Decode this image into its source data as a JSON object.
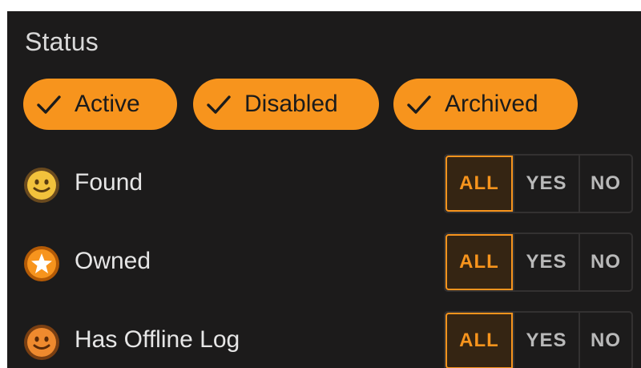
{
  "status": {
    "title": "Status",
    "chips": [
      {
        "label": "Active",
        "checked": true
      },
      {
        "label": "Disabled",
        "checked": true
      },
      {
        "label": "Archived",
        "checked": true
      }
    ],
    "chip_color": "#f7941d"
  },
  "filters": [
    {
      "label": "Found",
      "icon": "smiley-found-icon",
      "icon_color": "#f2c23c",
      "selected": "ALL"
    },
    {
      "label": "Owned",
      "icon": "star-owned-icon",
      "icon_color": "#f7941d",
      "selected": "ALL"
    },
    {
      "label": "Has Offline Log",
      "icon": "smiley-offline-log-icon",
      "icon_color": "#ef8a2e",
      "selected": "ALL"
    }
  ],
  "segment_options": {
    "all": "ALL",
    "yes": "YES",
    "no": "NO"
  },
  "accent_color": "#f7941d"
}
